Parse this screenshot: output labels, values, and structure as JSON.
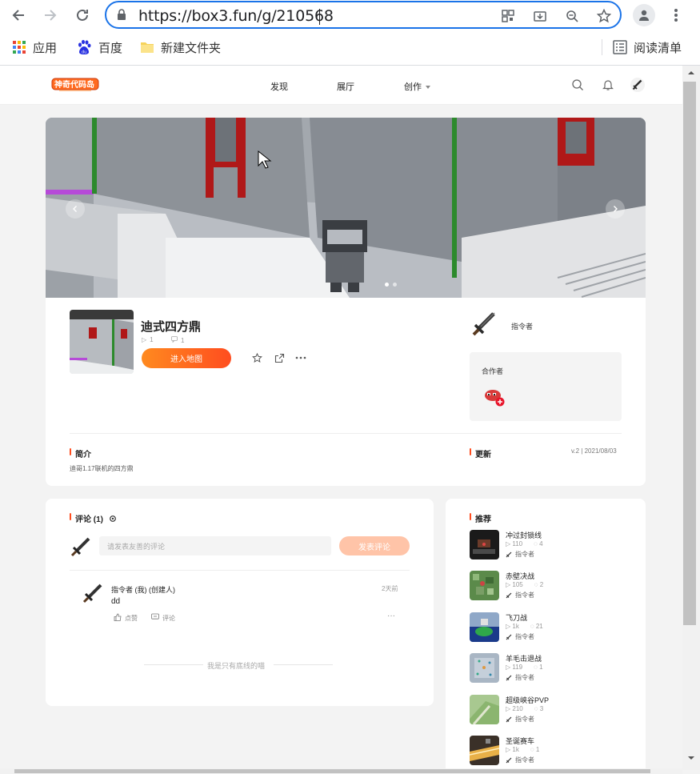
{
  "browser": {
    "url": "https://box3.fun/g/210568",
    "bookmarks": [
      {
        "label": "应用",
        "icon": "apps-grid-icon"
      },
      {
        "label": "百度",
        "icon": "baidu-paw-icon"
      },
      {
        "label": "新建文件夹",
        "icon": "folder-icon"
      }
    ],
    "reading_list": "阅读清单"
  },
  "site": {
    "logo_text": "神奇代码岛",
    "nav": [
      "发现",
      "展厅",
      "创作"
    ]
  },
  "game": {
    "title": "迪式四方鼎",
    "plays": "1",
    "comments": "1",
    "play_button": "进入地图",
    "author": "指令者",
    "collaborators_label": "合作者",
    "intro_label": "简介",
    "intro_text": "迪哥1.17联机的四方鼎",
    "update_label": "更新",
    "update_info": "v.2 | 2021/08/03"
  },
  "comments": {
    "header": "评论 (1)",
    "input_placeholder": "请发表友善的评论",
    "submit_label": "发表评论",
    "items": [
      {
        "author": "指令者 (我) (创建人)",
        "time": "2天前",
        "text": "dd",
        "like_label": "点赞",
        "reply_label": "评论"
      }
    ],
    "end_text": "我是只有底线的喵"
  },
  "recommend": {
    "header": "推荐",
    "items": [
      {
        "title": "冲过封锁线",
        "plays": "110",
        "comments": "4",
        "author": "指令者"
      },
      {
        "title": "赤壁决战",
        "plays": "105",
        "comments": "2",
        "author": "指令者"
      },
      {
        "title": "飞刀战",
        "plays": "1k",
        "comments": "21",
        "author": "指令者"
      },
      {
        "title": "羊毛击退战",
        "plays": "119",
        "comments": "1",
        "author": "指令者"
      },
      {
        "title": "超级峡谷PVP",
        "plays": "210",
        "comments": "3",
        "author": "指令者"
      },
      {
        "title": "圣诞赛车",
        "plays": "1k",
        "comments": "1",
        "author": "指令者"
      }
    ]
  },
  "colors": {
    "accent": "#ff5a1f",
    "browser_focus": "#1a73e8"
  }
}
